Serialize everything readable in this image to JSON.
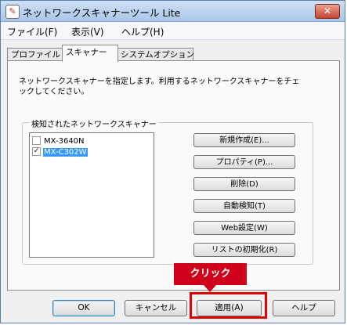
{
  "window": {
    "title": "ネットワークスキャナーツール Lite",
    "close_symbol": "✕",
    "app_icon": "scanner-app-icon"
  },
  "menu": {
    "items": [
      "ファイル(F)",
      "表示(V)",
      "ヘルプ(H)"
    ]
  },
  "tabs": [
    {
      "label": "プロファイル",
      "active": false
    },
    {
      "label": "スキャナー",
      "active": true
    },
    {
      "label": "システムオプション",
      "active": false
    }
  ],
  "scanner_tab": {
    "description": "ネットワークスキャナーを指定します。利用するネットワークスキャナーをチェックしてください。",
    "group_label": "検知されたネットワークスキャナー",
    "scanners": [
      {
        "name": "MX-3640N",
        "checked": false,
        "selected": false
      },
      {
        "name": "MX-C302W",
        "checked": true,
        "selected": true
      }
    ],
    "buttons": [
      "新規作成(E)...",
      "プロパティ(P)...",
      "削除(D)",
      "自動検知(T)",
      "Web設定(W)",
      "リストの初期化(R)"
    ]
  },
  "footer": {
    "ok": "OK",
    "cancel": "キャンセル",
    "apply": "適用(A)",
    "help": "ヘルプ"
  },
  "annotation": {
    "label": "クリック",
    "color": "#d0021b"
  }
}
